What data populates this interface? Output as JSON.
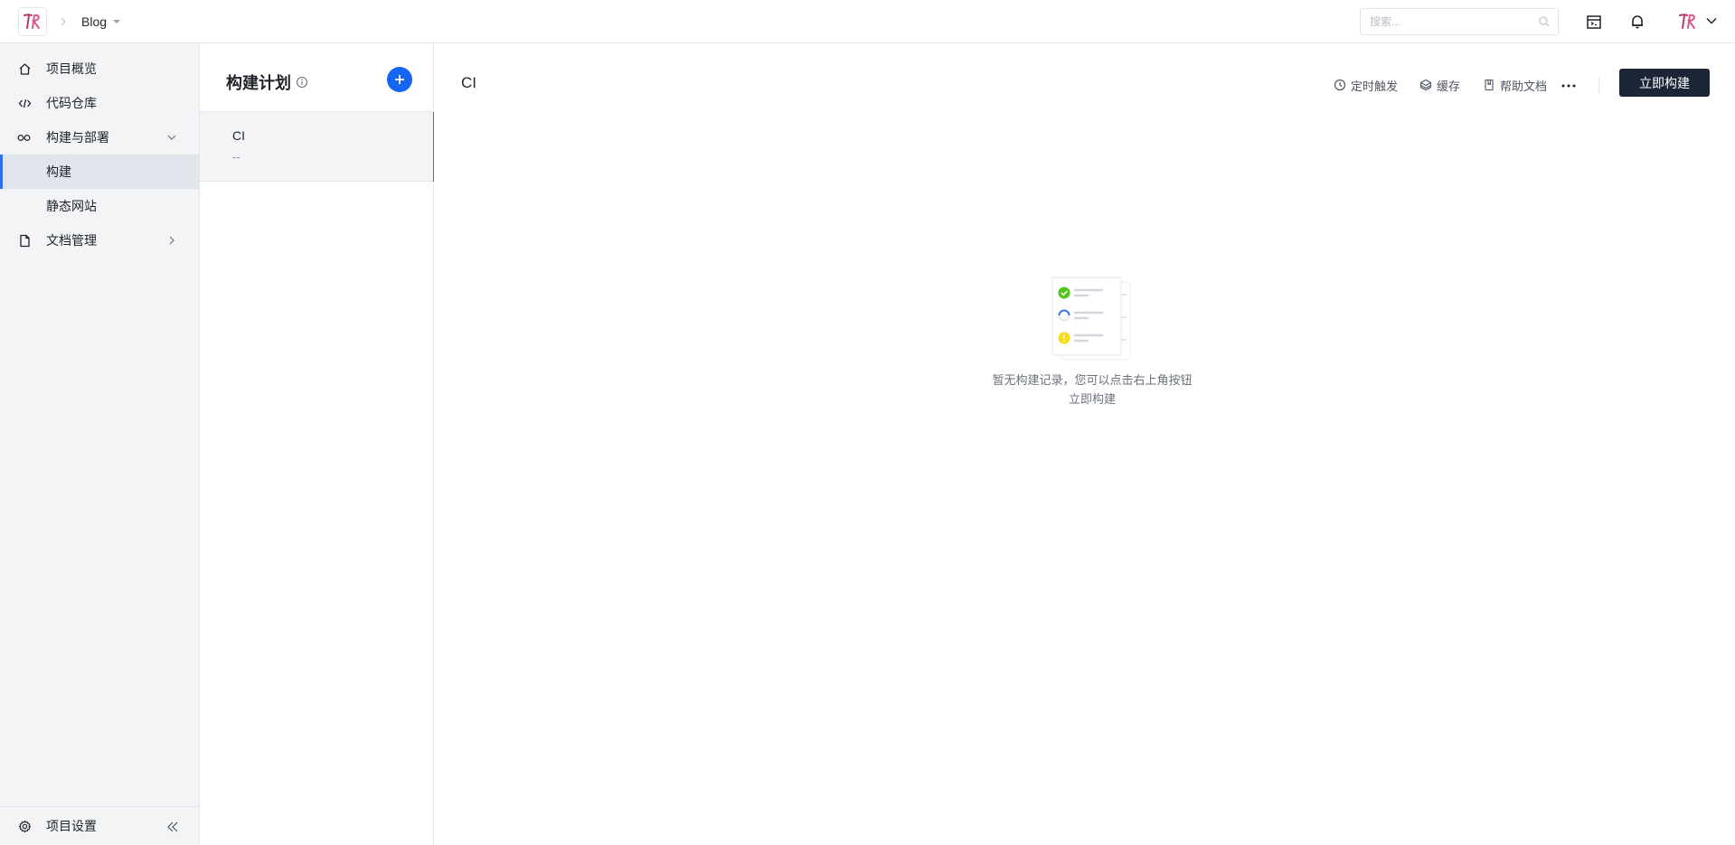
{
  "header": {
    "project_name": "Blog",
    "search_placeholder": "搜索..."
  },
  "sidebar": {
    "items": [
      {
        "label": "项目概览",
        "icon": "home-icon"
      },
      {
        "label": "代码仓库",
        "icon": "code-icon"
      },
      {
        "label": "构建与部署",
        "icon": "infinity-icon",
        "expanded": true
      },
      {
        "label": "构建",
        "active": true
      },
      {
        "label": "静态网站"
      },
      {
        "label": "文档管理",
        "icon": "document-icon"
      }
    ],
    "settings_label": "项目设置"
  },
  "plans": {
    "title": "构建计划",
    "items": [
      {
        "name": "CI",
        "sub": "--"
      }
    ]
  },
  "main": {
    "title": "CI",
    "toolbar": {
      "schedule_label": "定时触发",
      "cache_label": "缓存",
      "help_label": "帮助文档",
      "build_now_label": "立即构建"
    },
    "empty_line1": "暂无构建记录，您可以点击右上角按钮",
    "empty_line2": "立即构建"
  },
  "colors": {
    "accent": "#2f6fed",
    "add_button": "#1665f3",
    "primary_button": "#1c2536",
    "sidebar_bg": "#f3f4f6",
    "success": "#52c41a",
    "warning": "#fadb14"
  }
}
